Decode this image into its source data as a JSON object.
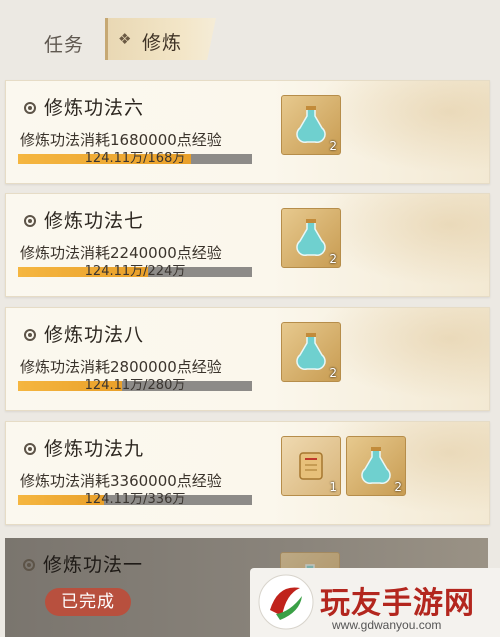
{
  "tabs": {
    "task_label": "任务",
    "active_label": "修炼"
  },
  "quests": [
    {
      "title": "修炼功法六",
      "desc": "修炼功法消耗1680000点经验",
      "progress_text": "124.11万/168万",
      "progress": 0.739,
      "rewards": [
        {
          "icon": "potion-icon",
          "count": "2"
        }
      ]
    },
    {
      "title": "修炼功法七",
      "desc": "修炼功法消耗2240000点经验",
      "progress_text": "124.11万/224万",
      "progress": 0.554,
      "rewards": [
        {
          "icon": "potion-icon",
          "count": "2"
        }
      ]
    },
    {
      "title": "修炼功法八",
      "desc": "修炼功法消耗2800000点经验",
      "progress_text": "124.11万/280万",
      "progress": 0.443,
      "rewards": [
        {
          "icon": "potion-icon",
          "count": "2"
        }
      ]
    },
    {
      "title": "修炼功法九",
      "desc": "修炼功法消耗3360000点经验",
      "progress_text": "124.11万/336万",
      "progress": 0.369,
      "rewards": [
        {
          "icon": "scroll-icon",
          "count": "1"
        },
        {
          "icon": "potion-icon",
          "count": "2"
        }
      ]
    }
  ],
  "done_quest": {
    "title": "修炼功法一",
    "badge": "已完成"
  },
  "watermark": {
    "text": "玩友手游网",
    "url": "www.gdwanyou.com"
  },
  "colors": {
    "progress_fill": "#f0ac35",
    "progress_track": "#8d8b88",
    "badge": "#b8503e",
    "watermark_text": "#b3261e"
  }
}
